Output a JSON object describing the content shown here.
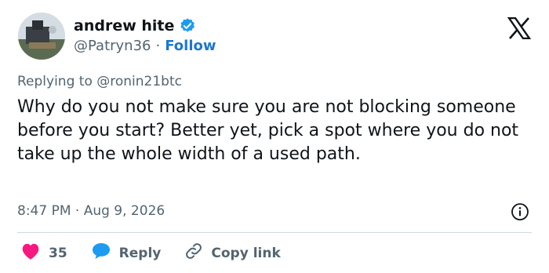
{
  "author": {
    "display_name": "andrew hite",
    "handle": "@Patryn36",
    "separator": "·",
    "follow_label": "Follow"
  },
  "reply_context": {
    "prefix": "Replying to",
    "mention": "@ronin21btc"
  },
  "tweet": {
    "text": "Why do you not make sure you are not blocking someone before you start? Better yet, pick a spot where you do not take up the whole width of a used path.",
    "timestamp": "8:47 PM · Aug 9, 2026"
  },
  "actions": {
    "like_count": "35",
    "reply_label": "Reply",
    "copy_link_label": "Copy link"
  },
  "colors": {
    "verified": "#1d9bf0",
    "follow": "#1d77cf",
    "like": "#f91880",
    "reply": "#1d9bf0",
    "muted": "#536471"
  },
  "icons": [
    "verified-badge-icon",
    "x-logo-icon",
    "info-icon",
    "heart-icon",
    "reply-bubble-icon",
    "link-icon"
  ]
}
